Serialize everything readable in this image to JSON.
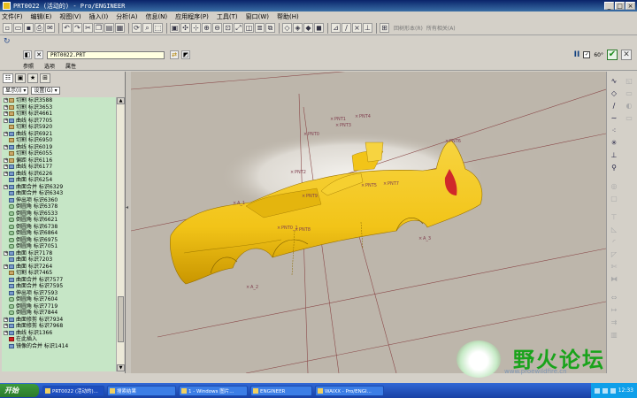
{
  "window": {
    "title": "PRT0022 (活动的) - Pro/ENGINEER"
  },
  "menu": [
    "文件(F)",
    "编辑(E)",
    "视图(V)",
    "插入(I)",
    "分析(A)",
    "信息(N)",
    "应用程序(P)",
    "工具(T)",
    "窗口(W)",
    "帮助(H)"
  ],
  "toolbar": {
    "right_text_1": "回树形本(R)",
    "right_text_2": "所有相关(A)"
  },
  "dashboard": {
    "feature_input": "PRT0022.PRT",
    "tabs": [
      "参照",
      "选项",
      "属性"
    ],
    "pause_label": "II",
    "check_label": "60°",
    "ok_label": "✔",
    "cancel_label": "✕"
  },
  "tree": {
    "show_label": "显示(I) ▾",
    "settings_label": "设置(G) ▾",
    "rows": [
      {
        "exp": true,
        "icon": "cut",
        "text": "切割 标识3588"
      },
      {
        "exp": true,
        "icon": "cut",
        "text": "切割 标识3653"
      },
      {
        "exp": true,
        "icon": "cut",
        "text": "切割 标识4661"
      },
      {
        "exp": true,
        "icon": "curve",
        "text": "曲线 标识7705"
      },
      {
        "exp": false,
        "icon": "cut",
        "text": "切割 标识5920"
      },
      {
        "exp": true,
        "icon": "curve",
        "text": "曲线 标识6921"
      },
      {
        "exp": false,
        "icon": "cut",
        "text": "切割 标识6950"
      },
      {
        "exp": true,
        "icon": "curve",
        "text": "曲线 标识6019"
      },
      {
        "exp": false,
        "icon": "cut",
        "text": "切割 标识6055"
      },
      {
        "exp": true,
        "icon": "cut",
        "text": "偏距 标识6116"
      },
      {
        "exp": true,
        "icon": "curve",
        "text": "曲线 标识6177"
      },
      {
        "exp": true,
        "icon": "curve",
        "text": "曲线 标识6226"
      },
      {
        "exp": false,
        "icon": "surf",
        "text": "曲面 标识6254"
      },
      {
        "exp": true,
        "icon": "surf",
        "text": "曲面合并 标识6329"
      },
      {
        "exp": false,
        "icon": "surf",
        "text": "曲面合并 标识6343"
      },
      {
        "exp": false,
        "icon": "surf",
        "text": "伸出项 标识6360"
      },
      {
        "exp": false,
        "icon": "round",
        "text": "倒圆角 标识6378"
      },
      {
        "exp": false,
        "icon": "round",
        "text": "倒圆角 标识6533"
      },
      {
        "exp": false,
        "icon": "round",
        "text": "倒圆角 标识6621"
      },
      {
        "exp": false,
        "icon": "round",
        "text": "倒圆角 标识6738"
      },
      {
        "exp": false,
        "icon": "round",
        "text": "倒圆角 标识6864"
      },
      {
        "exp": false,
        "icon": "round",
        "text": "倒圆角 标识6975"
      },
      {
        "exp": false,
        "icon": "round",
        "text": "倒圆角 标识7051"
      },
      {
        "exp": true,
        "icon": "surf",
        "text": "曲面 标识7178"
      },
      {
        "exp": false,
        "icon": "surf",
        "text": "曲面 标识7203"
      },
      {
        "exp": true,
        "icon": "surf",
        "text": "曲面 标识7264"
      },
      {
        "exp": false,
        "icon": "cut",
        "text": "切割 标识7465"
      },
      {
        "exp": false,
        "icon": "surf",
        "text": "曲面合并 标识7577"
      },
      {
        "exp": false,
        "icon": "surf",
        "text": "曲面合并 标识7595"
      },
      {
        "exp": false,
        "icon": "surf",
        "text": "伸出项 标识7593"
      },
      {
        "exp": false,
        "icon": "round",
        "text": "倒圆角 标识7604"
      },
      {
        "exp": false,
        "icon": "round",
        "text": "倒圆角 标识7719"
      },
      {
        "exp": false,
        "icon": "round",
        "text": "倒圆角 标识7844"
      },
      {
        "exp": true,
        "icon": "surf",
        "text": "曲面修剪 标识7934"
      },
      {
        "exp": true,
        "icon": "surf",
        "text": "曲面修剪 标识7968"
      },
      {
        "exp": true,
        "icon": "curve",
        "text": "曲线 标识1366"
      },
      {
        "exp": false,
        "icon": "insert",
        "text": "在此插入"
      },
      {
        "exp": false,
        "icon": "surf",
        "text": "镜像的合并 标识1414"
      }
    ]
  },
  "viewport": {
    "labels": [
      "PNT1",
      "PNT0",
      "PNT2",
      "PNT3",
      "PNT4",
      "PNT5",
      "PNT6",
      "PNT7",
      "PNT8",
      "PNT9",
      "PNT0_1",
      "A_3",
      "A_2",
      "A_1"
    ],
    "body_color": "#f2c418",
    "bg_color": "#bdb6ab"
  },
  "taskbar": {
    "start": "开始",
    "tasks": [
      "PRT0022 (活动的)...",
      "搜索结果",
      "1 - Windows 图片...",
      "ENGINEER",
      "WAIXX - Pro/ENGI..."
    ],
    "clock": "12:33"
  },
  "watermark": {
    "brand": "野火论坛",
    "url": "www.proewildfire.cn"
  }
}
